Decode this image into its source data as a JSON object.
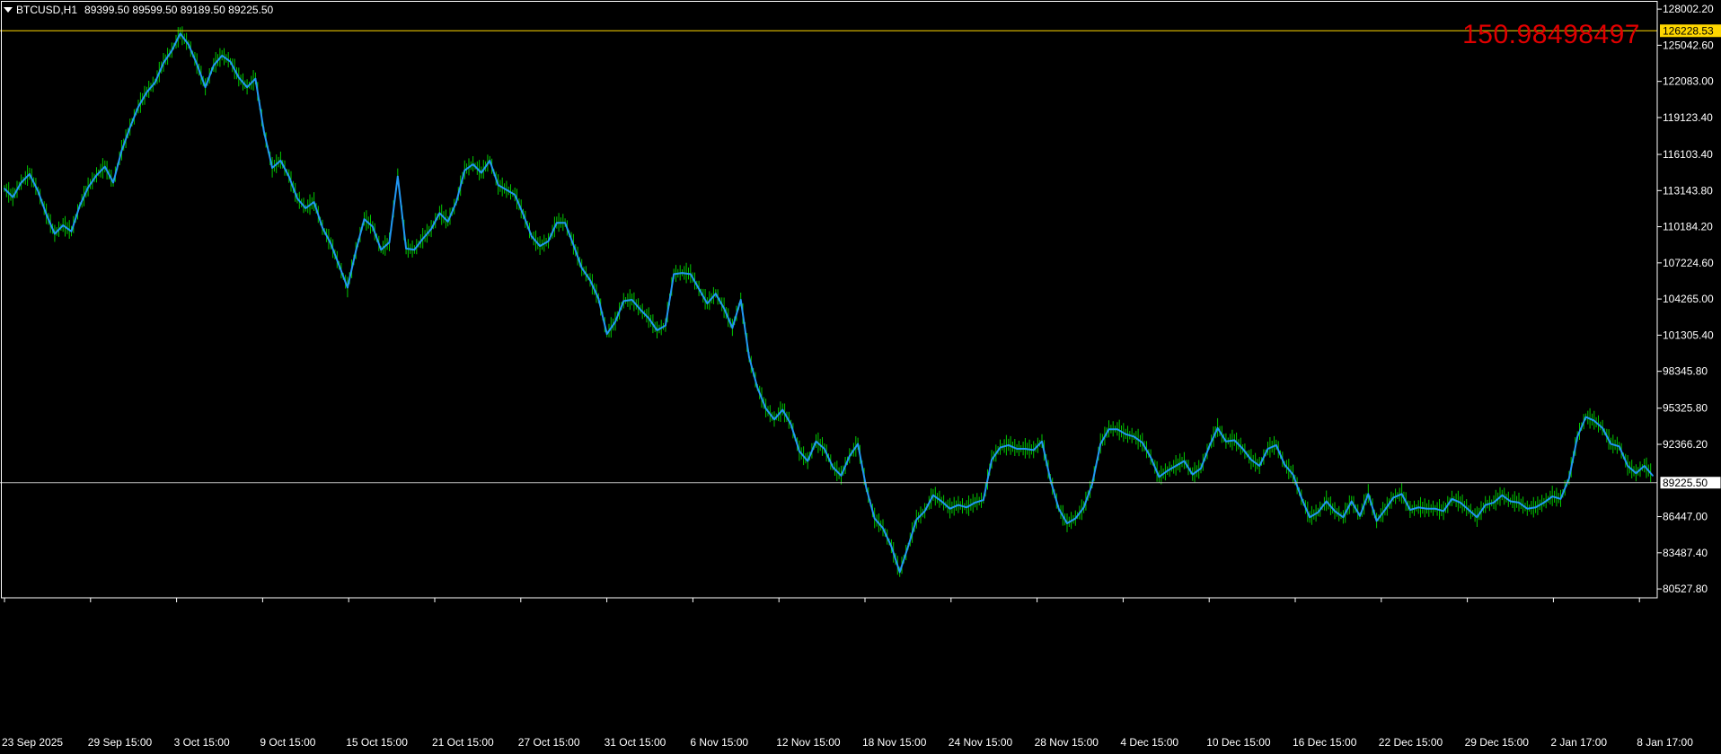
{
  "header": {
    "symbol": "BTCUSD,H1",
    "ohlc": "89399.50 89599.50 89189.50 89225.50"
  },
  "indicator_value": "150.98498497",
  "colors": {
    "background": "#000000",
    "price_line": "#2196F3",
    "wick": "#00C800",
    "axis": "#FFFFFF",
    "level_line": "#FFD700",
    "bid_line": "#C0C0C0",
    "indicator_text": "#E00000"
  },
  "chart_data": {
    "type": "line",
    "title": "BTCUSD,H1",
    "series": [
      {
        "name": "BTCUSD",
        "values": [
          113300,
          112600,
          113800,
          114500,
          113100,
          111200,
          109600,
          110300,
          109800,
          111900,
          113400,
          114400,
          115100,
          113800,
          116400,
          118300,
          120000,
          121200,
          122000,
          123600,
          124600,
          126000,
          125100,
          123500,
          121600,
          123400,
          124200,
          123700,
          122400,
          121600,
          122300,
          118000,
          115000,
          115600,
          114300,
          112500,
          111700,
          112200,
          110100,
          108800,
          107000,
          105200,
          108200,
          110800,
          110200,
          108300,
          108900,
          114300,
          108400,
          108300,
          109200,
          110000,
          111300,
          110600,
          112200,
          114800,
          115300,
          114600,
          115600,
          113600,
          113200,
          112800,
          111200,
          109400,
          108600,
          109000,
          110500,
          110500,
          108700,
          106800,
          105800,
          104300,
          101400,
          102400,
          104100,
          104200,
          103400,
          102700,
          101700,
          102100,
          106300,
          106400,
          106300,
          105100,
          103900,
          104700,
          103500,
          101900,
          104200,
          99500,
          97000,
          95300,
          94400,
          95200,
          94000,
          91800,
          91000,
          92600,
          92000,
          90500,
          89800,
          91400,
          92400,
          88800,
          86300,
          85500,
          84000,
          81900,
          84000,
          86200,
          86900,
          88200,
          87700,
          87100,
          87400,
          87200,
          87600,
          87800,
          91100,
          92100,
          92300,
          92000,
          92000,
          91900,
          92600,
          89500,
          87100,
          85900,
          86300,
          87200,
          89100,
          92400,
          93600,
          93600,
          93200,
          93000,
          92500,
          91300,
          89700,
          90200,
          90600,
          91000,
          89900,
          90400,
          92200,
          93700,
          92600,
          92700,
          92000,
          91100,
          90600,
          92000,
          92300,
          90700,
          89900,
          88000,
          86400,
          86800,
          87700,
          86900,
          86400,
          87700,
          86500,
          88300,
          86100,
          87000,
          88000,
          88300,
          87000,
          87200,
          87100,
          87100,
          86900,
          87900,
          87600,
          87000,
          86400,
          87400,
          87600,
          88200,
          87700,
          87600,
          87100,
          87200,
          87600,
          88100,
          87900,
          89600,
          93000,
          94600,
          94300,
          93700,
          92400,
          92200,
          90600,
          90000,
          90600,
          89800
        ]
      }
    ],
    "y_axis": {
      "ticks": [
        "128002.20",
        "125042.60",
        "122083.00",
        "119123.40",
        "116103.40",
        "113143.80",
        "110184.20",
        "107224.60",
        "104265.00",
        "101305.40",
        "98345.80",
        "95325.80",
        "92366.20",
        "89225.50",
        "86447.00",
        "83487.40",
        "80527.80"
      ],
      "ylim": [
        79800,
        128600
      ]
    },
    "x_axis": {
      "ticks": [
        "23 Sep 2025",
        "29 Sep 15:00",
        "3 Oct 15:00",
        "9 Oct 15:00",
        "15 Oct 15:00",
        "21 Oct 15:00",
        "27 Oct 15:00",
        "31 Oct 15:00",
        "6 Nov 15:00",
        "12 Nov 15:00",
        "18 Nov 15:00",
        "24 Nov 15:00",
        "28 Nov 15:00",
        "4 Dec 15:00",
        "10 Dec 15:00",
        "16 Dec 15:00",
        "22 Dec 15:00",
        "29 Dec 15:00",
        "2 Jan 17:00",
        "8 Jan 17:00"
      ]
    },
    "horizontal_lines": [
      {
        "label": "126228.53",
        "value": 126228.53,
        "color": "#FFD700"
      },
      {
        "label": "89225.50",
        "value": 89225.5,
        "color": "#C0C0C0"
      }
    ],
    "grid": false,
    "legend": "none"
  }
}
